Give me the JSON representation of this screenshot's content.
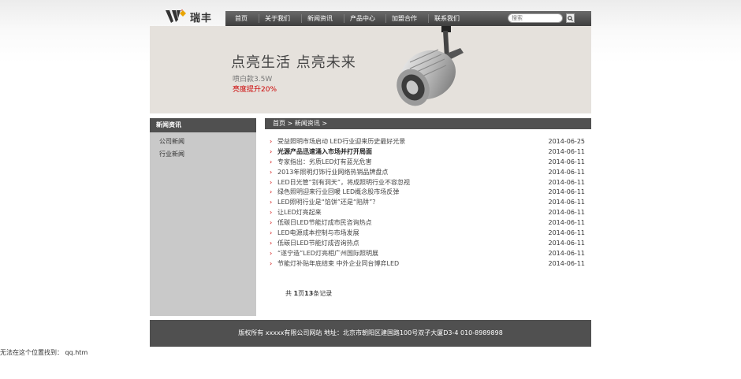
{
  "brand": {
    "name": "瑞丰"
  },
  "nav": {
    "items": [
      "首页",
      "关于我们",
      "新闻资讯",
      "产品中心",
      "加盟合作",
      "联系我们"
    ],
    "search_placeholder": "搜索"
  },
  "banner": {
    "title": "点亮生活 点亮未来",
    "subtitle": "喷白款3.5W",
    "highlight": "亮度提升20%"
  },
  "sidebar": {
    "heading": "新闻资讯",
    "items": [
      "公司新闻",
      "行业新闻"
    ]
  },
  "breadcrumb": "首页 > 新闻资讯 >",
  "news": [
    {
      "title": "受益照明市场启动 LED行业迎来历史最好光景",
      "date": "2014-06-25",
      "bold": false
    },
    {
      "title": "光源产品迅速涌入市场并打开局面",
      "date": "2014-06-11",
      "bold": true
    },
    {
      "title": "专家指出：劣质LED灯有蓝光危害",
      "date": "2014-06-11",
      "bold": false
    },
    {
      "title": "2013年照明灯饰行业网络热销品牌盘点",
      "date": "2014-06-11",
      "bold": false
    },
    {
      "title": "LED日光管“别有洞天”，将成照明行业不容忽视",
      "date": "2014-06-11",
      "bold": false
    },
    {
      "title": "绿色照明迎来行业回暖 LED概念股市场反弹",
      "date": "2014-06-11",
      "bold": false
    },
    {
      "title": "LED照明行业是“馅饼”还是“陷阱”？",
      "date": "2014-06-11",
      "bold": false
    },
    {
      "title": "让LED灯亮起来",
      "date": "2014-06-11",
      "bold": false
    },
    {
      "title": "低碳日LED节能灯成市民咨询热点",
      "date": "2014-06-11",
      "bold": false
    },
    {
      "title": "LED电源成本控制与市场发展",
      "date": "2014-06-11",
      "bold": false
    },
    {
      "title": "低碳日LED节能灯成咨询热点",
      "date": "2014-06-11",
      "bold": false
    },
    {
      "title": "“遂宁造”LED灯亮相广州国际照明展",
      "date": "2014-06-11",
      "bold": false
    },
    {
      "title": "节能灯补贴年底结束 中外企业同台博弈LED",
      "date": "2014-06-11",
      "bold": false
    }
  ],
  "pager": {
    "prefix": "共 ",
    "pages": "1",
    "pages_suffix": "页",
    "records": "13",
    "records_suffix": "条记录"
  },
  "footer": "版权所有 xxxxx有限公司网站 地址：北京市朝阳区建国路100号双子大厦D3-4 010-8989898",
  "error_text": "无法在这个位置找到： qq.htm",
  "colors": {
    "accent": "#cc0000",
    "dark_bar": "#505050",
    "sidebar_bg": "#c9c9c9",
    "banner_bg": "#e5e1dc"
  }
}
